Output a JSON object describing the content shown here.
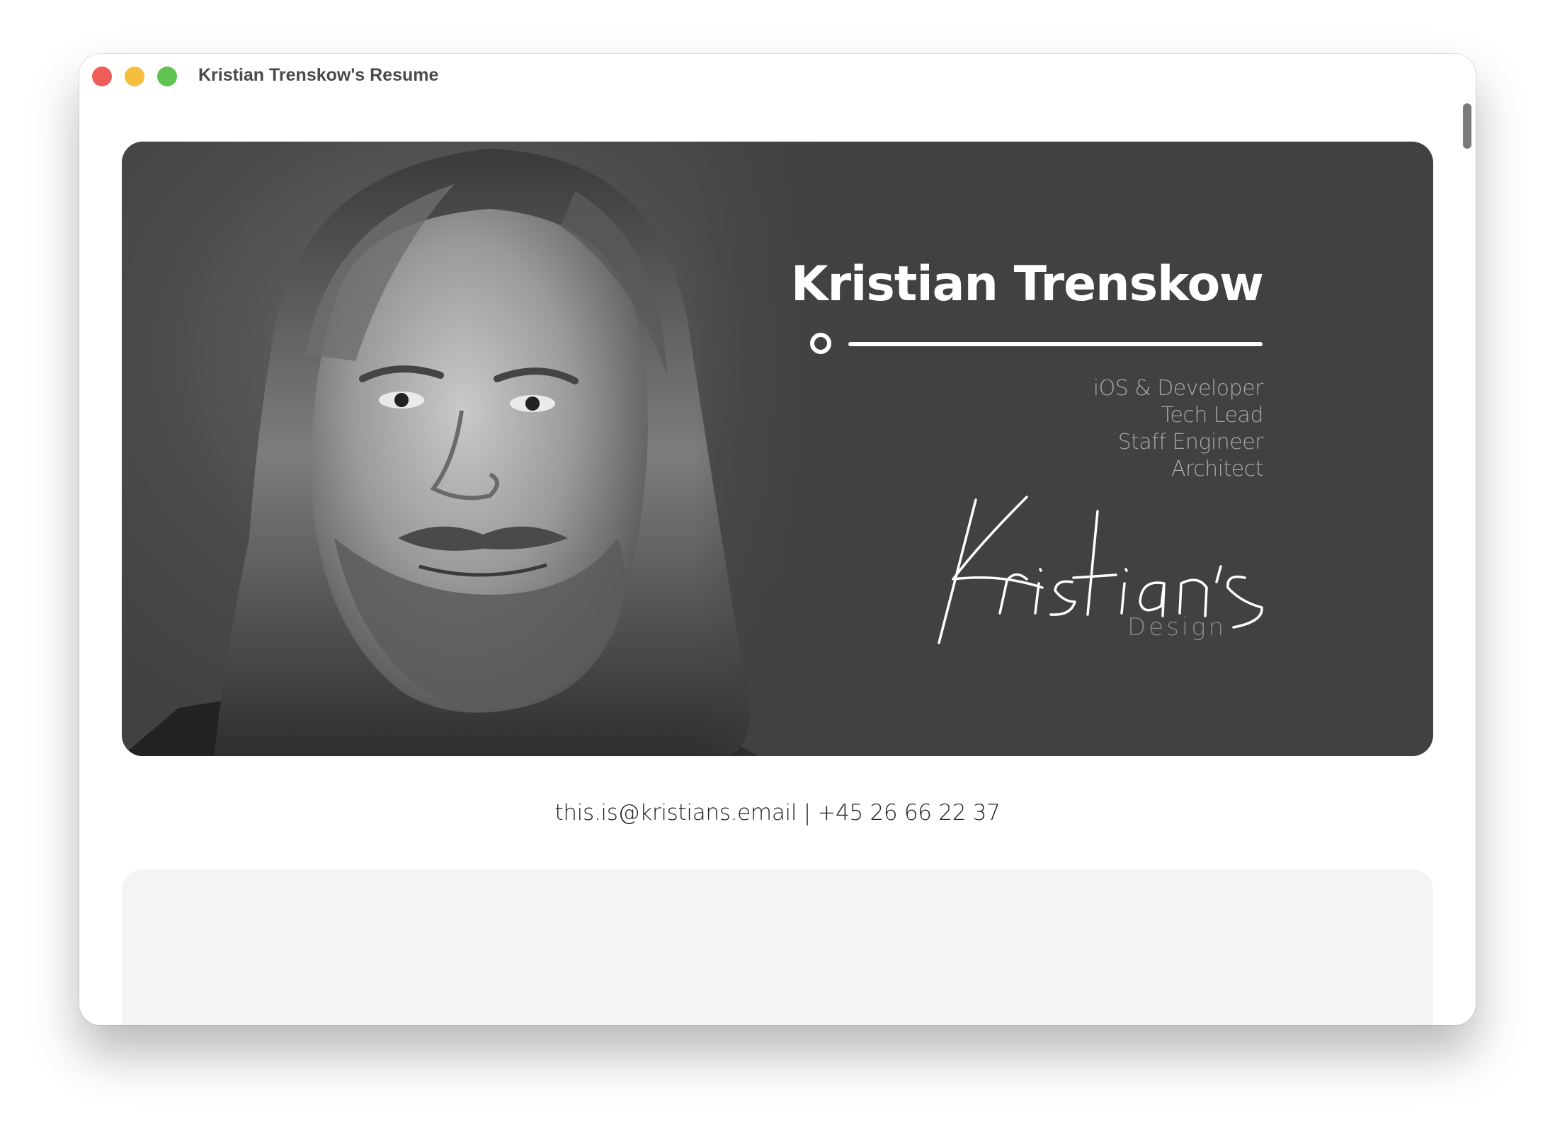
{
  "window": {
    "title": "Kristian Trenskow's Resume",
    "traffic_lights": {
      "close_color": "#ee5d58",
      "minimize_color": "#f5bf3d",
      "maximize_color": "#5ec34f"
    }
  },
  "hero": {
    "background_color": "#414141",
    "name": "Kristian Trenskow",
    "roles": [
      "iOS & Developer",
      "Tech Lead",
      "Staff Engineer",
      "Architect"
    ],
    "logo": {
      "script_text": "Kristian's",
      "subtitle": "Design"
    },
    "portrait_icon": "portrait-photo"
  },
  "contact": {
    "line": "this.is@kristians.email | +45 26 66 22 37"
  }
}
